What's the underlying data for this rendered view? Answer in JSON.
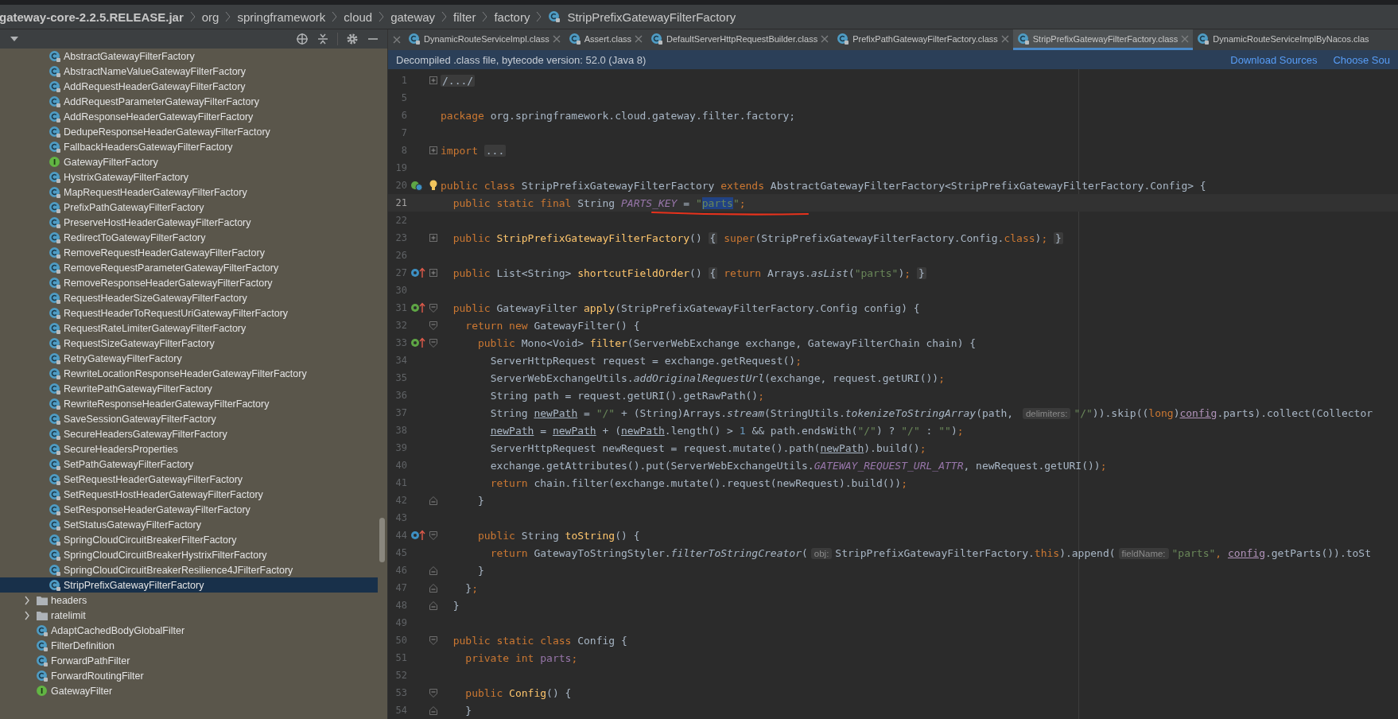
{
  "breadcrumb": [
    {
      "label": "gateway-core-2.2.5.RELEASE.jar",
      "kind": "jar"
    },
    {
      "label": "org",
      "kind": "package"
    },
    {
      "label": "springframework",
      "kind": "package"
    },
    {
      "label": "cloud",
      "kind": "package"
    },
    {
      "label": "gateway",
      "kind": "package"
    },
    {
      "label": "filter",
      "kind": "package"
    },
    {
      "label": "factory",
      "kind": "package"
    },
    {
      "label": "StripPrefixGatewayFilterFactory",
      "kind": "class"
    }
  ],
  "project_panel": {
    "tree": [
      {
        "kind": "group",
        "children": [
          {
            "label": "AbstractGatewayFilterFactory",
            "kind": "class",
            "selected": false
          },
          {
            "label": "AbstractNameValueGatewayFilterFactory",
            "kind": "class",
            "selected": false
          },
          {
            "label": "AddRequestHeaderGatewayFilterFactory",
            "kind": "class",
            "selected": false
          },
          {
            "label": "AddRequestParameterGatewayFilterFactory",
            "kind": "class",
            "selected": false
          },
          {
            "label": "AddResponseHeaderGatewayFilterFactory",
            "kind": "class",
            "selected": false
          },
          {
            "label": "DedupeResponseHeaderGatewayFilterFactory",
            "kind": "class",
            "selected": false
          },
          {
            "label": "FallbackHeadersGatewayFilterFactory",
            "kind": "class",
            "selected": false
          },
          {
            "label": "GatewayFilterFactory",
            "kind": "interface",
            "selected": false
          },
          {
            "label": "HystrixGatewayFilterFactory",
            "kind": "class",
            "selected": false
          },
          {
            "label": "MapRequestHeaderGatewayFilterFactory",
            "kind": "class",
            "selected": false
          },
          {
            "label": "PrefixPathGatewayFilterFactory",
            "kind": "class",
            "selected": false
          },
          {
            "label": "PreserveHostHeaderGatewayFilterFactory",
            "kind": "class",
            "selected": false
          },
          {
            "label": "RedirectToGatewayFilterFactory",
            "kind": "class",
            "selected": false
          },
          {
            "label": "RemoveRequestHeaderGatewayFilterFactory",
            "kind": "class",
            "selected": false
          },
          {
            "label": "RemoveRequestParameterGatewayFilterFactory",
            "kind": "class",
            "selected": false
          },
          {
            "label": "RemoveResponseHeaderGatewayFilterFactory",
            "kind": "class",
            "selected": false
          },
          {
            "label": "RequestHeaderSizeGatewayFilterFactory",
            "kind": "class",
            "selected": false
          },
          {
            "label": "RequestHeaderToRequestUriGatewayFilterFactory",
            "kind": "class",
            "selected": false
          },
          {
            "label": "RequestRateLimiterGatewayFilterFactory",
            "kind": "class",
            "selected": false
          },
          {
            "label": "RequestSizeGatewayFilterFactory",
            "kind": "class",
            "selected": false
          },
          {
            "label": "RetryGatewayFilterFactory",
            "kind": "class",
            "selected": false
          },
          {
            "label": "RewriteLocationResponseHeaderGatewayFilterFactory",
            "kind": "class",
            "selected": false
          },
          {
            "label": "RewritePathGatewayFilterFactory",
            "kind": "class",
            "selected": false
          },
          {
            "label": "RewriteResponseHeaderGatewayFilterFactory",
            "kind": "class",
            "selected": false
          },
          {
            "label": "SaveSessionGatewayFilterFactory",
            "kind": "class",
            "selected": false
          },
          {
            "label": "SecureHeadersGatewayFilterFactory",
            "kind": "class",
            "selected": false
          },
          {
            "label": "SecureHeadersProperties",
            "kind": "class",
            "selected": false
          },
          {
            "label": "SetPathGatewayFilterFactory",
            "kind": "class",
            "selected": false
          },
          {
            "label": "SetRequestHeaderGatewayFilterFactory",
            "kind": "class",
            "selected": false
          },
          {
            "label": "SetRequestHostHeaderGatewayFilterFactory",
            "kind": "class",
            "selected": false
          },
          {
            "label": "SetResponseHeaderGatewayFilterFactory",
            "kind": "class",
            "selected": false
          },
          {
            "label": "SetStatusGatewayFilterFactory",
            "kind": "class",
            "selected": false
          },
          {
            "label": "SpringCloudCircuitBreakerFilterFactory",
            "kind": "class",
            "selected": false
          },
          {
            "label": "SpringCloudCircuitBreakerHystrixFilterFactory",
            "kind": "class",
            "selected": false
          },
          {
            "label": "SpringCloudCircuitBreakerResilience4JFilterFactory",
            "kind": "class",
            "selected": false
          },
          {
            "label": "StripPrefixGatewayFilterFactory",
            "kind": "class",
            "selected": true
          }
        ]
      },
      {
        "label": "headers",
        "kind": "folder",
        "expanded": false,
        "selected": false
      },
      {
        "label": "ratelimit",
        "kind": "folder",
        "expanded": false,
        "selected": false
      },
      {
        "label": "AdaptCachedBodyGlobalFilter",
        "kind": "class",
        "selected": false
      },
      {
        "label": "FilterDefinition",
        "kind": "class",
        "selected": false
      },
      {
        "label": "ForwardPathFilter",
        "kind": "class",
        "selected": false
      },
      {
        "label": "ForwardRoutingFilter",
        "kind": "class",
        "selected": false
      },
      {
        "label": "GatewayFilter",
        "kind": "interface",
        "selected": false
      }
    ]
  },
  "tabs": [
    {
      "label": "DynamicRouteServiceImpl.class",
      "selected": false
    },
    {
      "label": "Assert.class",
      "selected": false
    },
    {
      "label": "DefaultServerHttpRequestBuilder.class",
      "selected": false
    },
    {
      "label": "PrefixPathGatewayFilterFactory.class",
      "selected": false
    },
    {
      "label": "StripPrefixGatewayFilterFactory.class",
      "selected": true
    },
    {
      "label": "DynamicRouteServiceImplByNacos.clas",
      "selected": false
    }
  ],
  "banner": {
    "message": "Decompiled .class file, bytecode version: 52.0 (Java 8)",
    "links": [
      "Download Sources",
      "Choose Sou"
    ]
  },
  "editor": {
    "lines": [
      {
        "number": "1",
        "fold_marker": {
          "kind": "plus"
        },
        "current": false,
        "tokens": [
          {
            "kind": "folded",
            "text": "/.../"
          }
        ]
      },
      {
        "number": "5",
        "current": false
      },
      {
        "number": "6",
        "current": false,
        "tokens": [
          {
            "kind": "keyword",
            "text": "package "
          },
          {
            "kind": "plain",
            "text": "org.springframework.cloud.gateway.filter.factory;"
          }
        ]
      },
      {
        "number": "7",
        "current": false
      },
      {
        "number": "8",
        "fold_marker": {
          "kind": "plus"
        },
        "current": false,
        "tokens": [
          {
            "kind": "keyword",
            "text": "import "
          },
          {
            "kind": "folded",
            "text": "..."
          }
        ]
      },
      {
        "number": "19",
        "current": false
      },
      {
        "number": "20",
        "gutter_icon": {
          "kind": "subclassed"
        },
        "intention": true,
        "current": false,
        "tokens": [
          {
            "kind": "keyword",
            "text": "public class "
          },
          {
            "kind": "plain",
            "text": "StripPrefixGatewayFilterFactory "
          },
          {
            "kind": "keyword",
            "text": "extends "
          },
          {
            "kind": "plain",
            "text": "AbstractGatewayFilterFactory<StripPrefixGatewayFilterFactory.Config> {"
          }
        ]
      },
      {
        "number": "21",
        "current": true,
        "tokens": [
          {
            "kind": "keyword",
            "text": "  public static final "
          },
          {
            "kind": "plain",
            "text": "String "
          },
          {
            "kind": "static_field",
            "text": "PARTS_KEY"
          },
          {
            "kind": "plain",
            "text": " = "
          },
          {
            "kind": "string",
            "text": "\""
          },
          {
            "kind": "selected_string",
            "text": "parts"
          },
          {
            "kind": "string",
            "text": "\""
          },
          {
            "kind": "keyword",
            "text": ";"
          }
        ]
      },
      {
        "number": "22",
        "current": false
      },
      {
        "number": "23",
        "fold_marker": {
          "kind": "plus"
        },
        "current": false,
        "tokens": [
          {
            "kind": "keyword",
            "text": "  public "
          },
          {
            "kind": "declaration",
            "text": "StripPrefixGatewayFilterFactory"
          },
          {
            "kind": "plain",
            "text": "() "
          },
          {
            "kind": "folded",
            "text": "{"
          },
          {
            "kind": "keyword",
            "text": " super"
          },
          {
            "kind": "plain",
            "text": "(StripPrefixGatewayFilterFactory.Config."
          },
          {
            "kind": "keyword",
            "text": "class"
          },
          {
            "kind": "plain",
            "text": ")"
          },
          {
            "kind": "keyword",
            "text": "; "
          },
          {
            "kind": "folded",
            "text": "}"
          }
        ]
      },
      {
        "number": "26",
        "current": false
      },
      {
        "number": "27",
        "fold_marker": {
          "kind": "plus"
        },
        "gutter_icon": {
          "kind": "overrides"
        },
        "current": false,
        "tokens": [
          {
            "kind": "keyword",
            "text": "  public "
          },
          {
            "kind": "plain",
            "text": "List<String> "
          },
          {
            "kind": "declaration",
            "text": "shortcutFieldOrder"
          },
          {
            "kind": "plain",
            "text": "() "
          },
          {
            "kind": "folded",
            "text": "{"
          },
          {
            "kind": "keyword",
            "text": " return "
          },
          {
            "kind": "plain",
            "text": "Arrays."
          },
          {
            "kind": "static_call",
            "text": "asList"
          },
          {
            "kind": "plain",
            "text": "("
          },
          {
            "kind": "string",
            "text": "\"parts\""
          },
          {
            "kind": "plain",
            "text": ")"
          },
          {
            "kind": "keyword",
            "text": "; "
          },
          {
            "kind": "folded",
            "text": "}"
          }
        ]
      },
      {
        "number": "30",
        "current": false
      },
      {
        "number": "31",
        "fold_marker": {
          "kind": "open"
        },
        "gutter_icon": {
          "kind": "implements"
        },
        "current": false,
        "tokens": [
          {
            "kind": "keyword",
            "text": "  public "
          },
          {
            "kind": "plain",
            "text": "GatewayFilter "
          },
          {
            "kind": "declaration",
            "text": "apply"
          },
          {
            "kind": "plain",
            "text": "(StripPrefixGatewayFilterFactory.Config config) {"
          }
        ]
      },
      {
        "number": "32",
        "fold_marker": {
          "kind": "open"
        },
        "current": false,
        "tokens": [
          {
            "kind": "keyword",
            "text": "    return new "
          },
          {
            "kind": "plain",
            "text": "GatewayFilter() {"
          }
        ]
      },
      {
        "number": "33",
        "fold_marker": {
          "kind": "open"
        },
        "gutter_icon": {
          "kind": "implements"
        },
        "current": false,
        "tokens": [
          {
            "kind": "keyword",
            "text": "      public "
          },
          {
            "kind": "plain",
            "text": "Mono<Void> "
          },
          {
            "kind": "declaration",
            "text": "filter"
          },
          {
            "kind": "plain",
            "text": "(ServerWebExchange exchange, GatewayFilterChain chain) {"
          }
        ]
      },
      {
        "number": "34",
        "current": false,
        "tokens": [
          {
            "kind": "plain",
            "text": "        ServerHttpRequest request = exchange.getRequest()"
          },
          {
            "kind": "keyword",
            "text": ";"
          }
        ]
      },
      {
        "number": "35",
        "current": false,
        "tokens": [
          {
            "kind": "plain",
            "text": "        ServerWebExchangeUtils."
          },
          {
            "kind": "static_call",
            "text": "addOriginalRequestUrl"
          },
          {
            "kind": "plain",
            "text": "(exchange, request.getURI())"
          },
          {
            "kind": "keyword",
            "text": ";"
          }
        ]
      },
      {
        "number": "36",
        "current": false,
        "tokens": [
          {
            "kind": "plain",
            "text": "        String path = request.getURI().getRawPath()"
          },
          {
            "kind": "keyword",
            "text": ";"
          }
        ]
      },
      {
        "number": "37",
        "current": false,
        "tokens": [
          {
            "kind": "plain",
            "text": "        String "
          },
          {
            "kind": "local_var",
            "text": "newPath"
          },
          {
            "kind": "plain",
            "text": " = "
          },
          {
            "kind": "string",
            "text": "\"/\""
          },
          {
            "kind": "plain",
            "text": " + (String)Arrays."
          },
          {
            "kind": "static_call",
            "text": "stream"
          },
          {
            "kind": "plain",
            "text": "(StringUtils."
          },
          {
            "kind": "static_call",
            "text": "tokenizeToStringArray"
          },
          {
            "kind": "plain",
            "text": "(path, "
          },
          {
            "kind": "hint",
            "text": "delimiters:"
          },
          {
            "kind": "string",
            "text": "\"/\""
          },
          {
            "kind": "plain",
            "text": ")).skip(("
          },
          {
            "kind": "keyword",
            "text": "long"
          },
          {
            "kind": "plain",
            "text": ")"
          },
          {
            "kind": "param",
            "text": "config"
          },
          {
            "kind": "plain",
            "text": ".parts).collect(Collector"
          }
        ]
      },
      {
        "number": "38",
        "current": false,
        "tokens": [
          {
            "kind": "local_var",
            "text": "        newPath"
          },
          {
            "kind": "plain",
            "text": " = "
          },
          {
            "kind": "local_var",
            "text": "newPath"
          },
          {
            "kind": "plain",
            "text": " + ("
          },
          {
            "kind": "local_var",
            "text": "newPath"
          },
          {
            "kind": "plain",
            "text": ".length() > "
          },
          {
            "kind": "number",
            "text": "1"
          },
          {
            "kind": "plain",
            "text": " && path.endsWith("
          },
          {
            "kind": "string",
            "text": "\"/\""
          },
          {
            "kind": "plain",
            "text": ") ? "
          },
          {
            "kind": "string",
            "text": "\"/\""
          },
          {
            "kind": "plain",
            "text": " : "
          },
          {
            "kind": "string",
            "text": "\"\""
          },
          {
            "kind": "plain",
            "text": ")"
          },
          {
            "kind": "keyword",
            "text": ";"
          }
        ]
      },
      {
        "number": "39",
        "current": false,
        "tokens": [
          {
            "kind": "plain",
            "text": "        ServerHttpRequest newRequest = request.mutate().path("
          },
          {
            "kind": "local_var",
            "text": "newPath"
          },
          {
            "kind": "plain",
            "text": ").build()"
          },
          {
            "kind": "keyword",
            "text": ";"
          }
        ]
      },
      {
        "number": "40",
        "current": false,
        "tokens": [
          {
            "kind": "plain",
            "text": "        exchange.getAttributes().put(ServerWebExchangeUtils."
          },
          {
            "kind": "static_field",
            "text": "GATEWAY_REQUEST_URL_ATTR"
          },
          {
            "kind": "plain",
            "text": ", newRequest.getURI())"
          },
          {
            "kind": "keyword",
            "text": ";"
          }
        ]
      },
      {
        "number": "41",
        "current": false,
        "tokens": [
          {
            "kind": "keyword",
            "text": "        return "
          },
          {
            "kind": "plain",
            "text": "chain.filter(exchange.mutate().request(newRequest).build())"
          },
          {
            "kind": "keyword",
            "text": ";"
          }
        ]
      },
      {
        "number": "42",
        "fold_marker": {
          "kind": "close"
        },
        "current": false,
        "tokens": [
          {
            "kind": "plain",
            "text": "      }"
          }
        ]
      },
      {
        "number": "43",
        "current": false
      },
      {
        "number": "44",
        "fold_marker": {
          "kind": "open"
        },
        "gutter_icon": {
          "kind": "overrides"
        },
        "current": false,
        "tokens": [
          {
            "kind": "keyword",
            "text": "      public "
          },
          {
            "kind": "plain",
            "text": "String "
          },
          {
            "kind": "declaration",
            "text": "toString"
          },
          {
            "kind": "plain",
            "text": "() {"
          }
        ]
      },
      {
        "number": "45",
        "current": false,
        "tokens": [
          {
            "kind": "keyword",
            "text": "        return "
          },
          {
            "kind": "plain",
            "text": "GatewayToStringStyler."
          },
          {
            "kind": "static_call",
            "text": "filterToStringCreator"
          },
          {
            "kind": "plain",
            "text": "("
          },
          {
            "kind": "hint",
            "text": "obj:"
          },
          {
            "kind": "plain",
            "text": "StripPrefixGatewayFilterFactory."
          },
          {
            "kind": "keyword",
            "text": "this"
          },
          {
            "kind": "plain",
            "text": ").append("
          },
          {
            "kind": "hint",
            "text": "fieldName:"
          },
          {
            "kind": "string",
            "text": "\"parts\""
          },
          {
            "kind": "keyword",
            "text": ", "
          },
          {
            "kind": "param",
            "text": "config"
          },
          {
            "kind": "plain",
            "text": ".getParts()).toSt"
          }
        ]
      },
      {
        "number": "46",
        "fold_marker": {
          "kind": "close"
        },
        "current": false,
        "tokens": [
          {
            "kind": "plain",
            "text": "      }"
          }
        ]
      },
      {
        "number": "47",
        "fold_marker": {
          "kind": "close"
        },
        "current": false,
        "tokens": [
          {
            "kind": "plain",
            "text": "    }"
          },
          {
            "kind": "keyword",
            "text": ";"
          }
        ]
      },
      {
        "number": "48",
        "fold_marker": {
          "kind": "close"
        },
        "current": false,
        "tokens": [
          {
            "kind": "plain",
            "text": "  }"
          }
        ]
      },
      {
        "number": "49",
        "current": false
      },
      {
        "number": "50",
        "fold_marker": {
          "kind": "open"
        },
        "current": false,
        "tokens": [
          {
            "kind": "keyword",
            "text": "  public static class "
          },
          {
            "kind": "plain",
            "text": "Config {"
          }
        ]
      },
      {
        "number": "51",
        "current": false,
        "tokens": [
          {
            "kind": "keyword",
            "text": "    private int "
          },
          {
            "kind": "field",
            "text": "parts"
          },
          {
            "kind": "keyword",
            "text": ";"
          }
        ]
      },
      {
        "number": "52",
        "current": false
      },
      {
        "number": "53",
        "fold_marker": {
          "kind": "open"
        },
        "current": false,
        "tokens": [
          {
            "kind": "keyword",
            "text": "    public "
          },
          {
            "kind": "declaration",
            "text": "Config"
          },
          {
            "kind": "plain",
            "text": "() {"
          }
        ]
      },
      {
        "number": "54",
        "fold_marker": {
          "kind": "close"
        },
        "current": false,
        "tokens": [
          {
            "kind": "plain",
            "text": "    }"
          }
        ]
      }
    ]
  }
}
